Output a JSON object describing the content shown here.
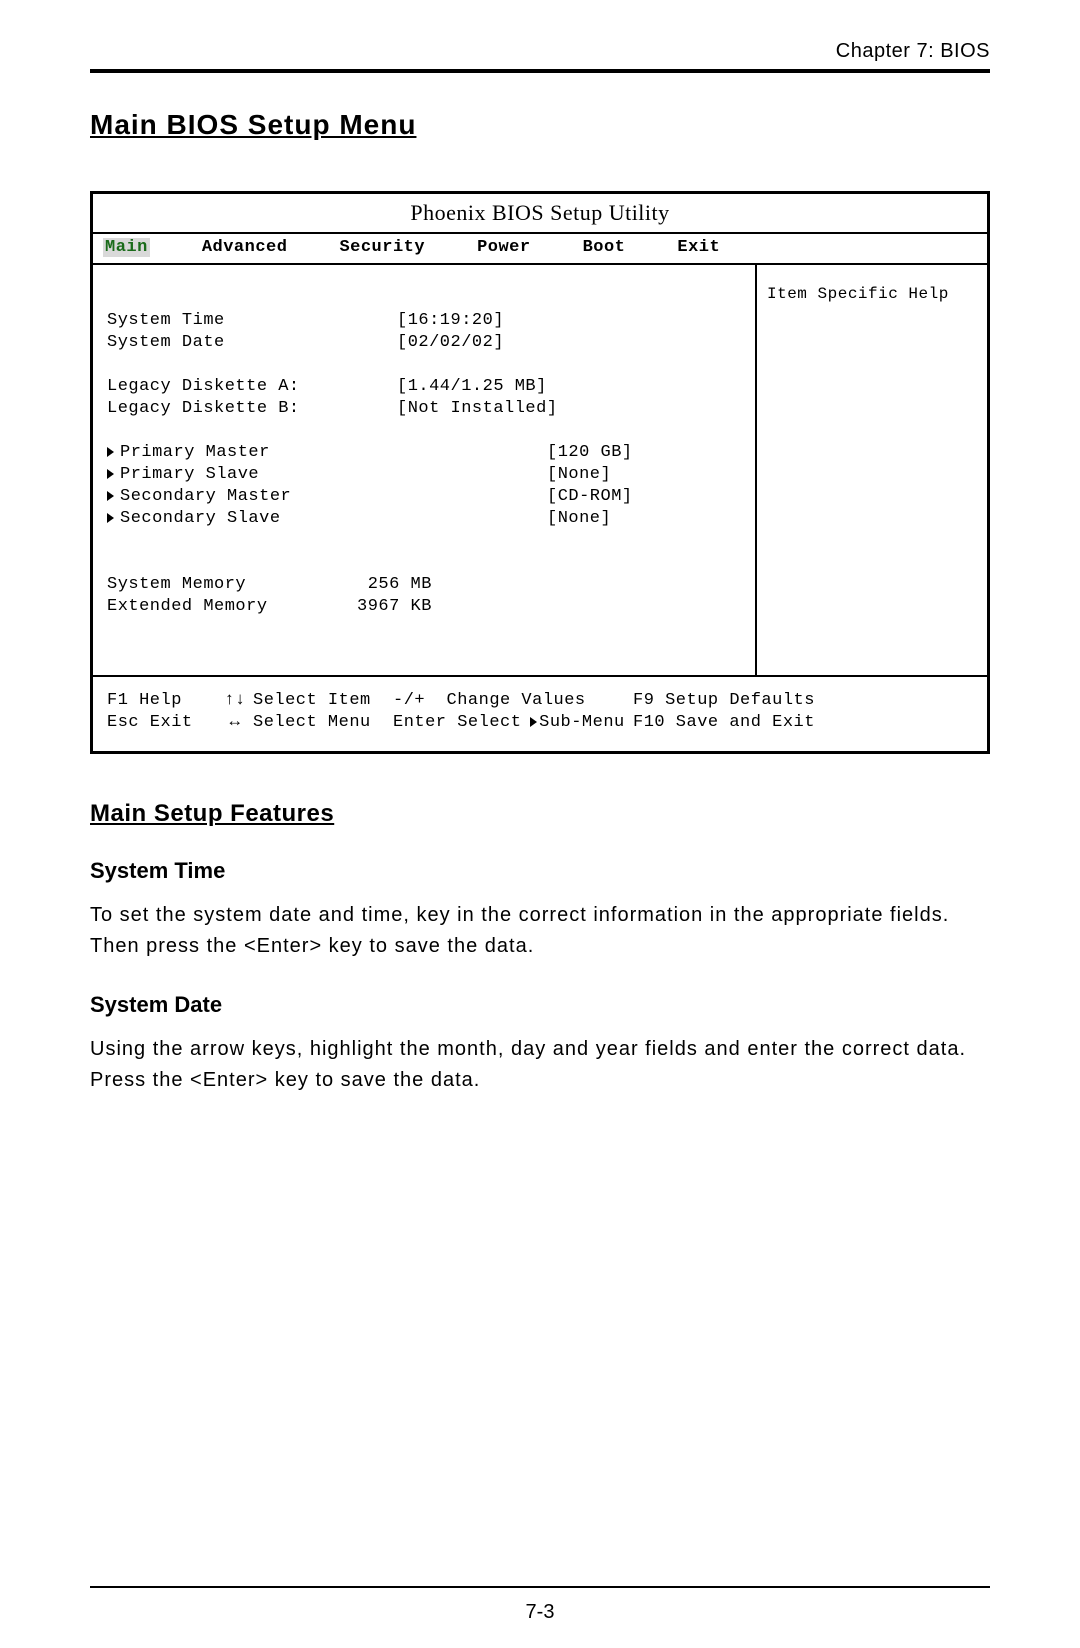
{
  "header": {
    "chapter": "Chapter 7: BIOS"
  },
  "title": "Main BIOS Setup Menu",
  "bios": {
    "title": "Phoenix BIOS Setup Utility",
    "tabs": {
      "main": "Main",
      "advanced": "Advanced",
      "security": "Security",
      "power": "Power",
      "boot": "Boot",
      "exit": "Exit"
    },
    "help_header": "Item Specific Help",
    "rows": {
      "system_time": {
        "label": "System Time",
        "value": "[16:19:20]"
      },
      "system_date": {
        "label": "System Date",
        "value": "[02/02/02]"
      },
      "diskette_a": {
        "label": "Legacy Diskette A:",
        "value": "[1.44/1.25 MB]"
      },
      "diskette_b": {
        "label": "Legacy Diskette B:",
        "value": "[Not Installed]"
      },
      "pri_master": {
        "label": "Primary Master",
        "value": "[120 GB]"
      },
      "pri_slave": {
        "label": "Primary Slave",
        "value": "[None]"
      },
      "sec_master": {
        "label": "Secondary Master",
        "value": "[CD-ROM]"
      },
      "sec_slave": {
        "label": "Secondary Slave",
        "value": "[None]"
      },
      "sys_mem": {
        "label": "System Memory",
        "value": " 256 MB"
      },
      "ext_mem": {
        "label": "Extended Memory",
        "value": "3967 KB"
      }
    },
    "footer": {
      "f1": "F1 Help",
      "esc": "Esc Exit",
      "sel_item": "Select Item",
      "sel_menu": "Select Menu",
      "change": "-/+  Change Values",
      "enter": "Enter Select",
      "submenu": "Sub-Menu",
      "f9": "F9 Setup Defaults",
      "f10": "F10 Save and Exit"
    }
  },
  "features": {
    "heading": "Main Setup Features",
    "system_time": {
      "title": "System Time",
      "text": "To set the system date and time, key in the correct information in the appropriate fields.  Then press the <Enter> key to save the data."
    },
    "system_date": {
      "title": "System Date",
      "text": "Using the arrow keys, highlight the month, day and year fields and enter the correct data.  Press the <Enter> key to save the data."
    }
  },
  "page_num": "7-3"
}
